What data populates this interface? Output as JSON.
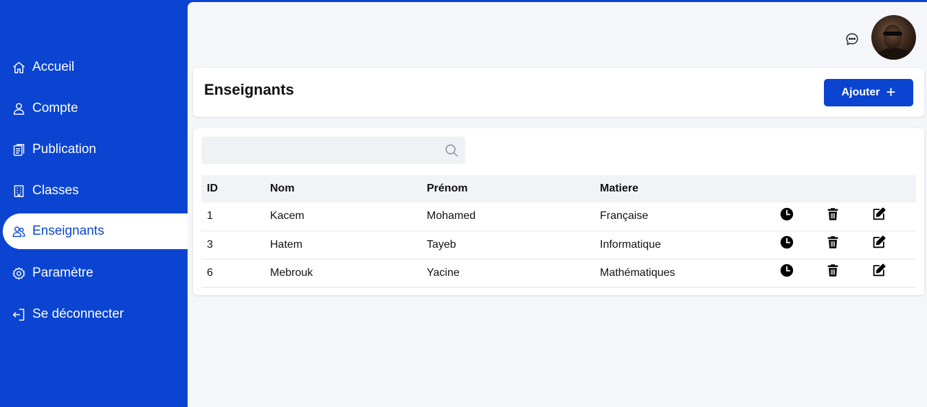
{
  "sidebar": {
    "items": [
      {
        "label": "Accueil",
        "icon": "home-icon"
      },
      {
        "label": "Compte",
        "icon": "user-icon"
      },
      {
        "label": "Publication",
        "icon": "clipboard-icon"
      },
      {
        "label": "Classes",
        "icon": "building-icon"
      },
      {
        "label": "Enseignants",
        "icon": "users-icon",
        "active": true
      },
      {
        "label": "Paramètre",
        "icon": "gear-icon"
      },
      {
        "label": "Se déconnecter",
        "icon": "logout-icon"
      }
    ]
  },
  "header": {
    "title": "Enseignants",
    "add_label": "Ajouter",
    "add_icon": "plus-icon"
  },
  "search": {
    "placeholder": "",
    "value": ""
  },
  "table": {
    "columns": [
      "ID",
      "Nom",
      "Prénom",
      "Matiere"
    ],
    "rows": [
      {
        "id": "1",
        "nom": "Kacem",
        "prenom": "Mohamed",
        "matiere": "Française"
      },
      {
        "id": "3",
        "nom": "Hatem",
        "prenom": "Tayeb",
        "matiere": "Informatique"
      },
      {
        "id": "6",
        "nom": "Mebrouk",
        "prenom": "Yacine",
        "matiere": "Mathématiques"
      }
    ],
    "row_actions": [
      "clock-icon",
      "trash-icon",
      "edit-icon"
    ]
  },
  "colors": {
    "primary": "#0a44d1",
    "background": "#f5f6fa",
    "card": "#ffffff"
  }
}
